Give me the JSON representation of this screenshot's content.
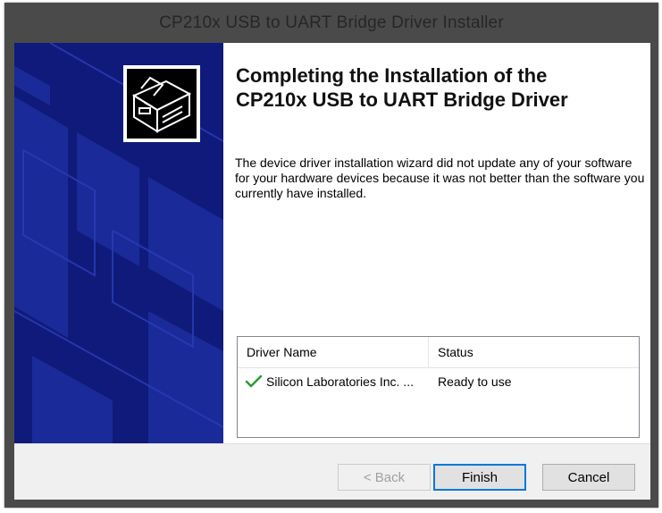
{
  "window": {
    "title": "CP210x USB to UART Bridge Driver Installer"
  },
  "banner": {
    "logo_icon": "hardware-install-icon",
    "color": "#0f1a7a"
  },
  "content": {
    "heading_line1": "Completing the Installation of the",
    "heading_line2": "CP210x USB to UART Bridge Driver",
    "message": "The device driver installation wizard did not update any of your software for your hardware devices because it was not better than the software you currently have installed."
  },
  "driver_list": {
    "columns": [
      "Driver Name",
      "Status"
    ],
    "rows": [
      {
        "icon": "checkmark-icon",
        "name": "Silicon Laboratories Inc. ...",
        "status": "Ready to use"
      }
    ]
  },
  "buttons": {
    "back_label": "< Back",
    "finish_label": "Finish",
    "cancel_label": "Cancel"
  }
}
